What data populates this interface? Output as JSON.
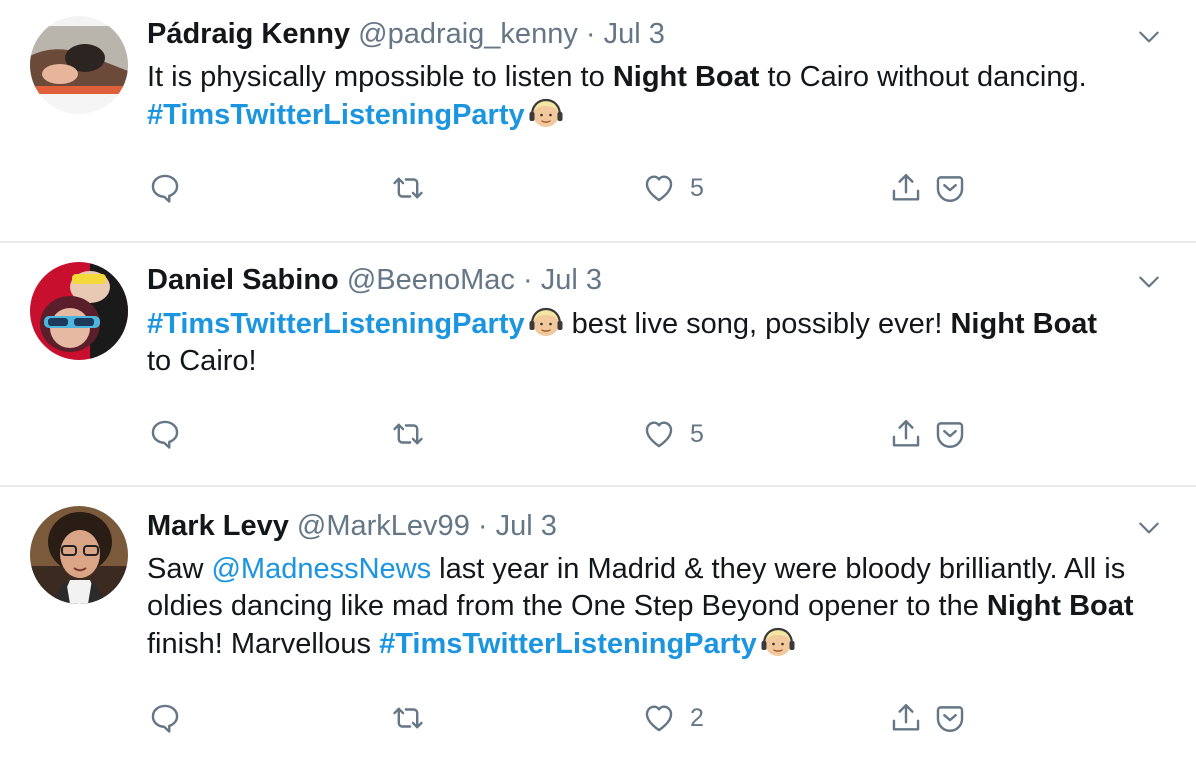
{
  "tweets": [
    {
      "name": "Pádraig Kenny",
      "handle": "@padraig_kenny",
      "separator": "·",
      "date": "Jul 3",
      "body": {
        "p1": "It is physically mpossible to listen to ",
        "b1": "Night Boat",
        "p2": " to Cairo without dancing.",
        "tag1": "#TimsTwitterListeningParty"
      },
      "likes": "5"
    },
    {
      "name": "Daniel Sabino",
      "handle": "@BeenoMac",
      "separator": "·",
      "date": "Jul 3",
      "body": {
        "tag1": "#TimsTwitterListeningParty",
        "p1": " best live song, possibly ever! ",
        "b1": "Night Boat",
        "p2": " to Cairo!"
      },
      "likes": "5"
    },
    {
      "name": "Mark Levy",
      "handle": "@MarkLev99",
      "separator": "·",
      "date": "Jul 3",
      "body": {
        "p1": "Saw ",
        "mention": "@MadnessNews",
        "p2": " last year in Madrid & they were bloody brilliantly. All is oldies dancing like mad from the One Step Beyond  opener to the ",
        "b1": "Night Boat",
        "p3": " finish! Marvellous ",
        "tag1": "#TimsTwitterListeningParty"
      },
      "likes": "2"
    }
  ],
  "icons": {
    "reply": "reply-icon",
    "retweet": "retweet-icon",
    "like": "heart-icon",
    "share": "share-icon",
    "dm": "dm-icon",
    "caret": "chevron-down-icon",
    "emoji": "person-headphones-emoji"
  },
  "colors": {
    "link": "#1b95e0",
    "muted": "#657786",
    "text": "#14171a",
    "divider": "#e6ecf0"
  }
}
